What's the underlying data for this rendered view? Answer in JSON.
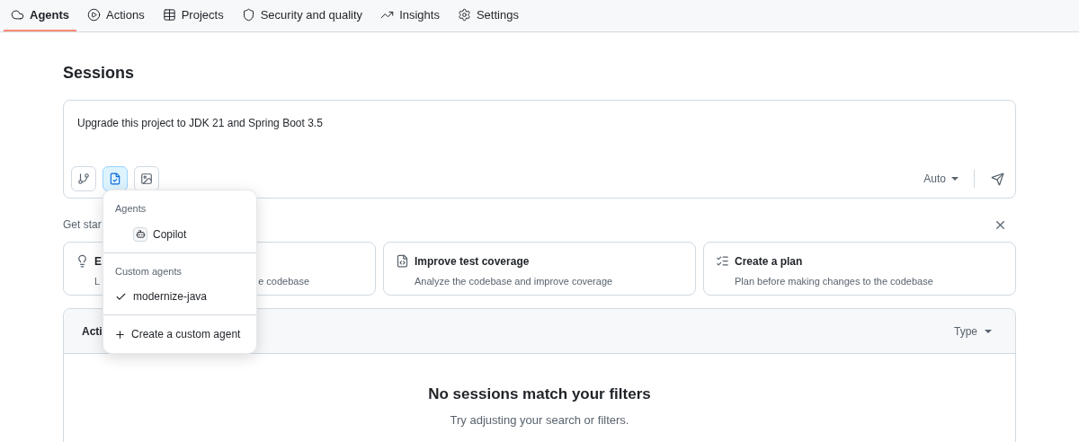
{
  "nav_tabs": [
    {
      "label": "Agents",
      "selected": true
    },
    {
      "label": "Actions",
      "selected": false
    },
    {
      "label": "Projects",
      "selected": false
    },
    {
      "label": "Security and quality",
      "selected": false
    },
    {
      "label": "Insights",
      "selected": false
    },
    {
      "label": "Settings",
      "selected": false
    }
  ],
  "heading": "Sessions",
  "prompt": {
    "value": "Upgrade this project to JDK 21 and Spring Boot 3.5",
    "tools": [
      {
        "selected": false
      },
      {
        "selected": true
      },
      {
        "selected": false
      }
    ],
    "model": "Auto"
  },
  "get_started_label": "Get star",
  "cards": [
    {
      "title": "E",
      "description_parts": [
        "L",
        "e codebase"
      ]
    },
    {
      "title": "Improve test coverage",
      "description_parts": [
        "Analyze the codebase and improve coverage"
      ]
    },
    {
      "title": "Create a plan",
      "description_parts": [
        "Plan before making changes to the codebase"
      ]
    }
  ],
  "sessions_panel": {
    "header": "Acti",
    "filter": "Type",
    "empty_title": "No sessions match your filters",
    "empty_hint": "Try adjusting your search or filters."
  },
  "agent_menu": {
    "sections": [
      {
        "label": "Agents",
        "items": [
          {
            "label": "Copilot",
            "kind": "agent",
            "checked": false
          }
        ]
      },
      {
        "label": "Custom agents",
        "items": [
          {
            "label": "modernize-java",
            "kind": "custom",
            "checked": true
          }
        ]
      }
    ],
    "create_label": "Create a custom agent"
  }
}
